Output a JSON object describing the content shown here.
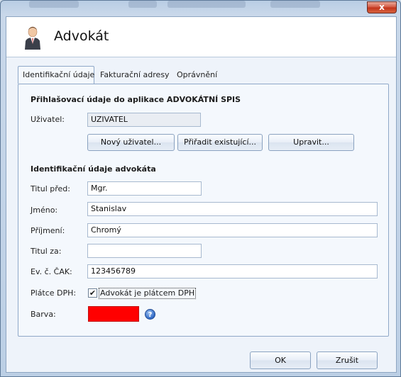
{
  "window": {
    "close_glyph": "x"
  },
  "header": {
    "title": "Advokát",
    "icon": "lawyer-person-icon"
  },
  "tabs": [
    {
      "label": "Identifikační údaje",
      "active": true
    },
    {
      "label": "Fakturační adresy",
      "active": false
    },
    {
      "label": "Oprávnění",
      "active": false
    }
  ],
  "login_section": {
    "title": "Přihlašovací údaje do aplikace ADVOKÁTNÍ SPIS",
    "user_label": "Uživatel:",
    "user_value": "UZIVATEL",
    "buttons": {
      "new_user": "Nový uživatel...",
      "assign_existing": "Přiřadit existující...",
      "edit": "Upravit..."
    }
  },
  "identity_section": {
    "title": "Identifikační údaje advokáta",
    "title_before_label": "Titul před:",
    "title_before_value": "Mgr.",
    "first_name_label": "Jméno:",
    "first_name_value": "Stanislav",
    "last_name_label": "Příjmení:",
    "last_name_value": "Chromý",
    "title_after_label": "Titul za:",
    "title_after_value": "",
    "cak_label": "Ev. č. ČAK:",
    "cak_value": "123456789",
    "vat_label": "Plátce DPH:",
    "vat_checkbox_label": "Advokát je plátcem DPH",
    "vat_checked": true,
    "color_label": "Barva:",
    "color_value": "#ff0000",
    "help_icon": "help-icon"
  },
  "footer": {
    "ok": "OK",
    "cancel": "Zrušit"
  }
}
